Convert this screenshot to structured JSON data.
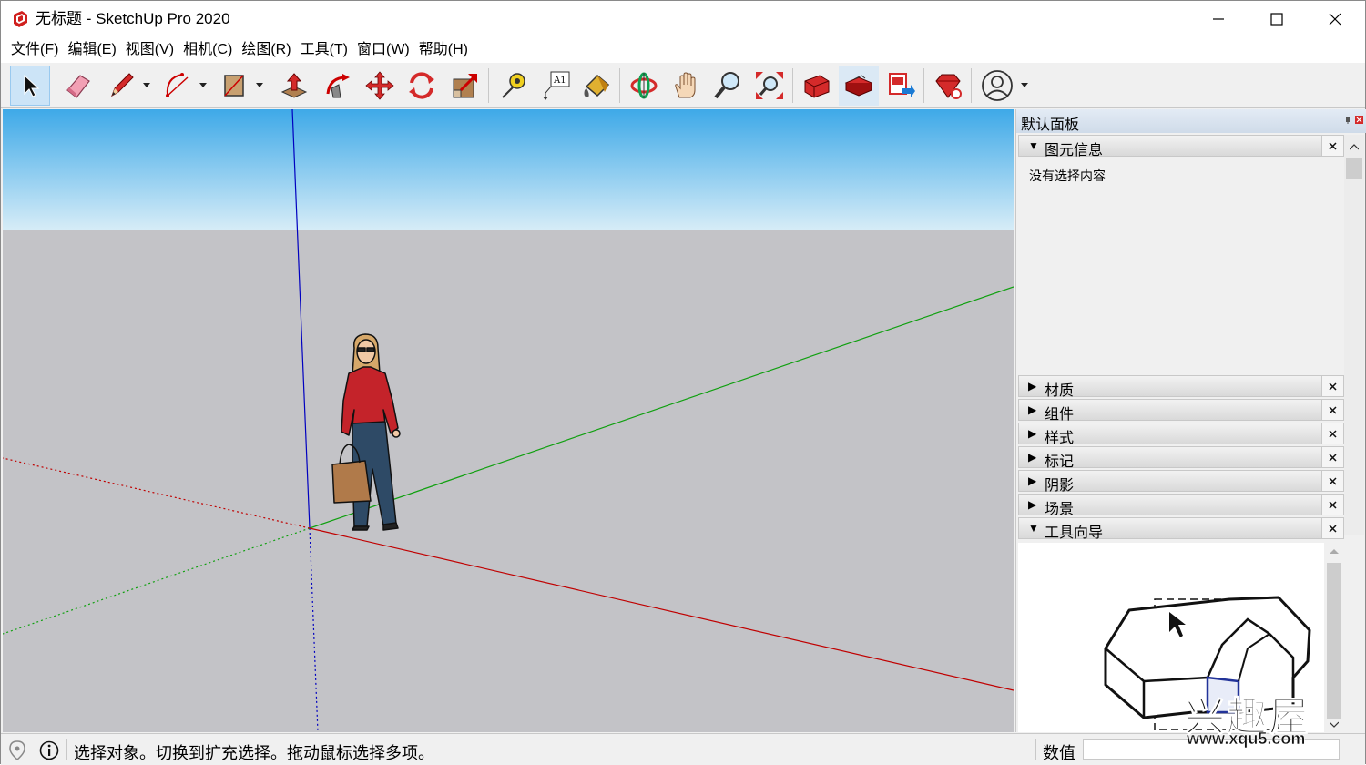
{
  "window": {
    "title": "无标题 - SketchUp Pro 2020"
  },
  "menu": [
    "文件(F)",
    "编辑(E)",
    "视图(V)",
    "相机(C)",
    "绘图(R)",
    "工具(T)",
    "窗口(W)",
    "帮助(H)"
  ],
  "toolbar": {
    "tools": [
      "select-icon",
      "eraser-icon",
      "pencil-icon",
      "arc-icon",
      "rectangle-icon",
      "push-pull-icon",
      "follow-me-icon",
      "move-icon",
      "rotate-icon",
      "scale-icon",
      "tape-measure-icon",
      "text-label-icon",
      "paint-bucket-icon",
      "orbit-icon",
      "pan-icon",
      "zoom-icon",
      "zoom-extents-icon",
      "warehouse-icon",
      "extension-warehouse-icon",
      "send-to-layout-icon",
      "extension-manager-icon",
      "account-icon"
    ],
    "text_tool_label": "A1"
  },
  "panel": {
    "title": "默认面板",
    "entity_info": {
      "label": "图元信息",
      "empty_text": "没有选择内容"
    },
    "trays": [
      "材质",
      "组件",
      "样式",
      "标记",
      "阴影",
      "场景"
    ],
    "instructor": {
      "label": "工具向导"
    }
  },
  "status": {
    "text": "选择对象。切换到扩充选择。拖动鼠标选择多项。",
    "measure_label": "数值"
  },
  "watermark": {
    "cn": "兴趣屋",
    "url": "www.xqu5.com"
  },
  "colors": {
    "sky_top": "#3ea9e8",
    "sky_bottom": "#d6ecf7",
    "ground": "#c3c3c7",
    "axis_red": "#c00000",
    "axis_green": "#10a010",
    "axis_blue": "#0000c0"
  }
}
